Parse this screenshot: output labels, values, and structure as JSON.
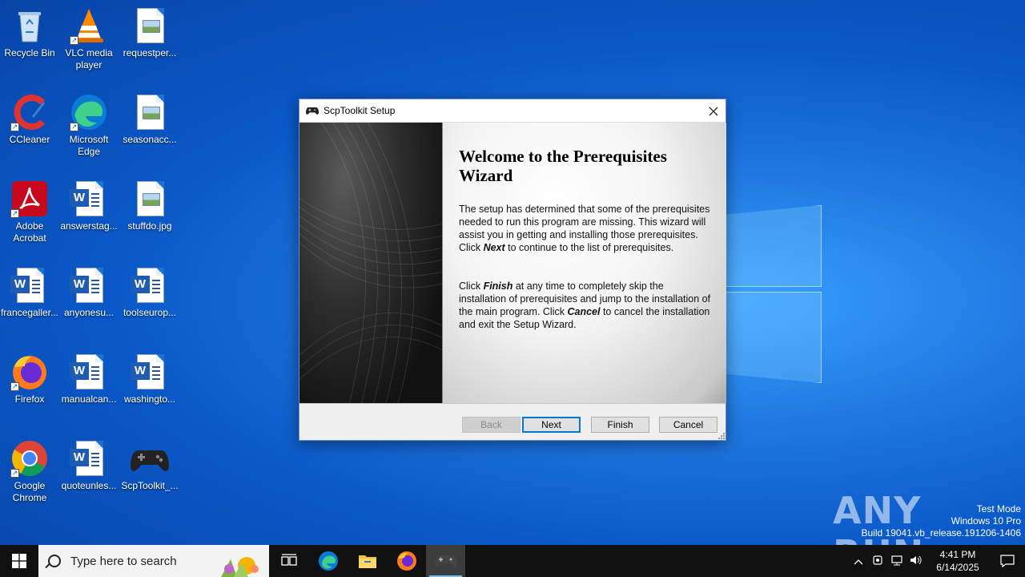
{
  "desktop": {
    "icons": [
      {
        "label": "Recycle Bin",
        "icon": "recycle-bin-icon"
      },
      {
        "label": "VLC media player",
        "icon": "vlc-icon"
      },
      {
        "label": "requestper...",
        "icon": "image-file-icon"
      },
      {
        "label": "CCleaner",
        "icon": "ccleaner-icon"
      },
      {
        "label": "Microsoft Edge",
        "icon": "edge-icon"
      },
      {
        "label": "seasonacc...",
        "icon": "image-file-icon"
      },
      {
        "label": "Adobe Acrobat",
        "icon": "acrobat-icon"
      },
      {
        "label": "answerstag...",
        "icon": "word-doc-icon"
      },
      {
        "label": "stuffdo.jpg",
        "icon": "image-file-icon"
      },
      {
        "label": "francegaller...",
        "icon": "word-doc-icon"
      },
      {
        "label": "anyonesu...",
        "icon": "word-doc-icon"
      },
      {
        "label": "toolseurop...",
        "icon": "word-doc-icon"
      },
      {
        "label": "Firefox",
        "icon": "firefox-icon"
      },
      {
        "label": "manualcan...",
        "icon": "word-doc-icon"
      },
      {
        "label": "washingto...",
        "icon": "word-doc-icon"
      },
      {
        "label": "Google Chrome",
        "icon": "chrome-icon"
      },
      {
        "label": "quoteunles...",
        "icon": "word-doc-icon"
      },
      {
        "label": "ScpToolkit_...",
        "icon": "gamepad-icon"
      }
    ]
  },
  "dialog": {
    "title": "ScpToolkit Setup",
    "heading": "Welcome to the Prerequisites Wizard",
    "para1_a": "The setup has determined that some of the prerequisites needed to run this program are missing. This wizard will assist you in getting and installing those prerequisites. Click ",
    "para1_b": "Next",
    "para1_c": " to continue to the list of prerequisites.",
    "para2_a": "Click ",
    "para2_b": "Finish",
    "para2_c": " at any time to completely skip the installation of prerequisites and jump to the installation of the main program. Click ",
    "para2_d": "Cancel",
    "para2_e": " to cancel the installation and exit the Setup Wizard.",
    "buttons": {
      "back": "Back",
      "next": "Next",
      "finish": "Finish",
      "cancel": "Cancel"
    }
  },
  "watermark": {
    "brand": "ANY RUN",
    "line1": "Test Mode",
    "line2": "Windows 10 Pro",
    "line3": "Build 19041.vb_release.191206-1406"
  },
  "taskbar": {
    "search_placeholder": "Type here to search",
    "time": "4:41 PM",
    "date": "6/14/2025"
  }
}
